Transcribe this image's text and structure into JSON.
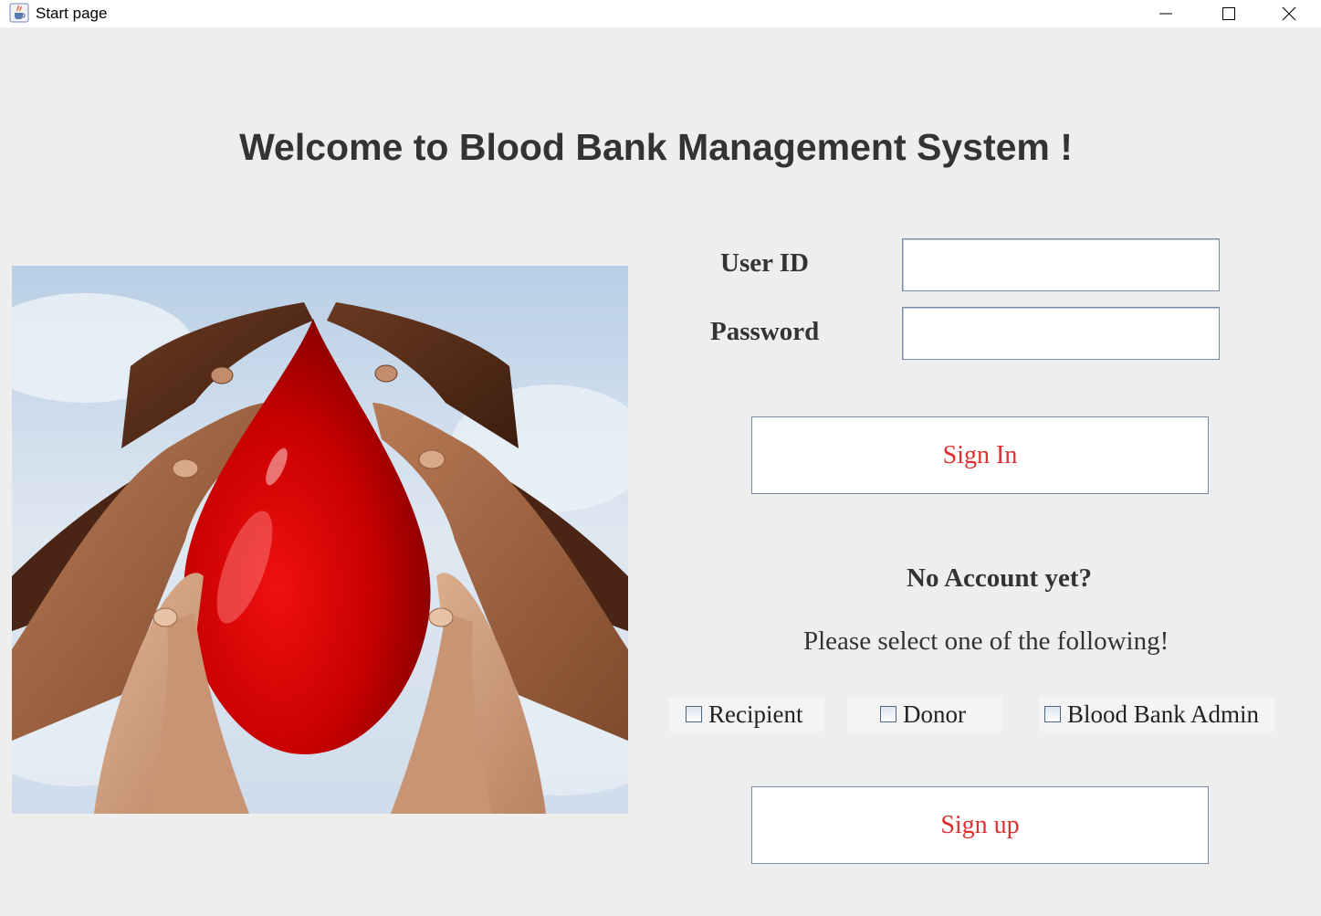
{
  "window": {
    "title": "Start page"
  },
  "heading": "Welcome to Blood Bank Management System !",
  "login": {
    "user_id_label": "User ID",
    "user_id_value": "",
    "password_label": "Password",
    "password_value": "",
    "sign_in_label": "Sign In"
  },
  "signup": {
    "prompt": "No Account yet?",
    "instruction": "Please select one of the following!",
    "options": [
      "Recipient",
      "Donor",
      "Blood Bank Admin"
    ],
    "sign_up_label": "Sign up"
  },
  "colors": {
    "background": "#eeeeee",
    "button_text": "#e03030",
    "heading_text": "#333333"
  },
  "icons": {
    "app": "java-cup-icon",
    "minimize": "minimize-icon",
    "maximize": "maximize-icon",
    "close": "close-icon"
  }
}
